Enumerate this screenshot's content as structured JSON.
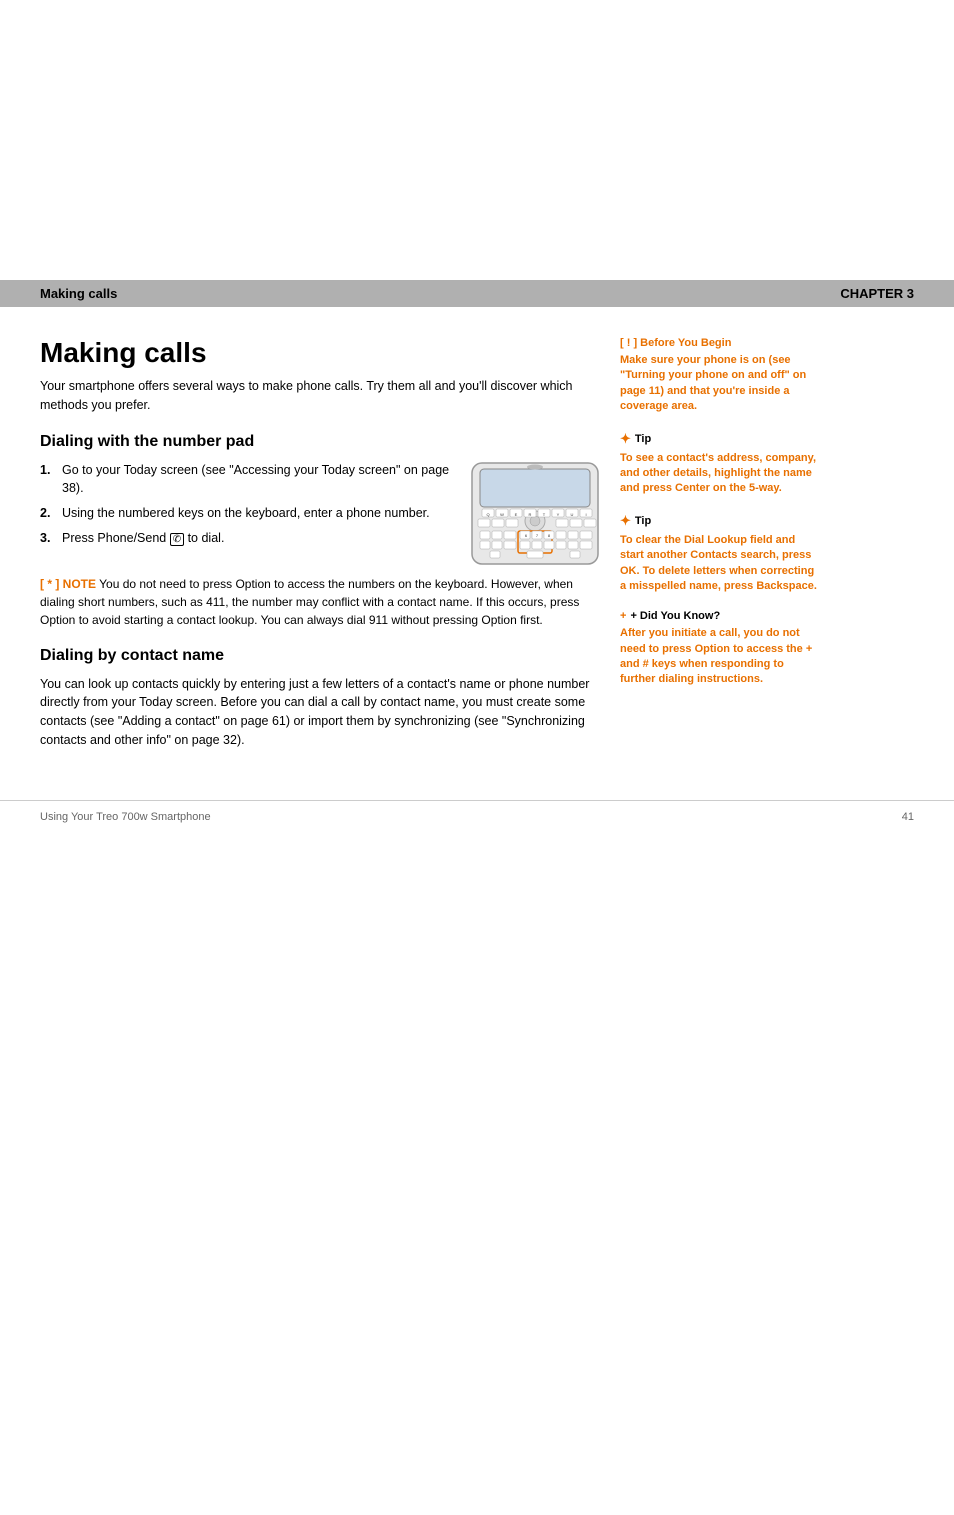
{
  "header": {
    "making_calls_label": "Making calls",
    "chapter_label": "CHAPTER 3"
  },
  "page_title": "Making calls",
  "intro": "Your smartphone offers several ways to make phone calls. Try them all and you'll discover which methods you prefer.",
  "section1": {
    "heading": "Dialing with the number pad",
    "steps": [
      {
        "num": "1.",
        "text": "Go to your Today screen (see \"Accessing your Today screen\" on page 38)."
      },
      {
        "num": "2.",
        "text": "Using the numbered keys on the keyboard, enter a phone number."
      },
      {
        "num": "3.",
        "text": "Press Phone/Send  to dial."
      }
    ],
    "note_label": "[ * ] NOTE",
    "note_text": "  You do not need to press Option to access the numbers on the keyboard. However, when dialing short numbers, such as 411, the number may conflict with a contact name. If this occurs, press Option  to avoid starting a contact lookup. You can always dial 911 without pressing Option first."
  },
  "section2": {
    "heading": "Dialing by contact name",
    "text": "You can look up contacts quickly by entering just a few letters of a contact's name or phone number directly from your Today screen. Before you can dial a call by contact name, you must create some contacts (see \"Adding a contact\" on page 61) or import them by synchronizing (see \"Synchronizing contacts and other info\" on page 32)."
  },
  "sidebar": {
    "before_begin_prefix": "[ ! ] Before You Begin",
    "before_begin_body": "Make sure your phone is on (see \"Turning your phone on and off\" on page 11) and that you're inside a coverage area.",
    "tip1_label": "Tip",
    "tip1_body": "To see a contact's address, company, and other details, highlight the name and press Center on the 5-way.",
    "tip2_label": "Tip",
    "tip2_body": "To clear the Dial Lookup field and start another Contacts search, press OK. To delete letters when correcting a misspelled name, press Backspace.",
    "did_you_know_label": "+ Did You Know?",
    "did_you_know_body": "After you initiate a call, you do not need to press Option to access the + and # keys when responding to further dialing instructions."
  },
  "footer": {
    "left": "Using Your Treo 700w Smartphone",
    "right": "41"
  }
}
